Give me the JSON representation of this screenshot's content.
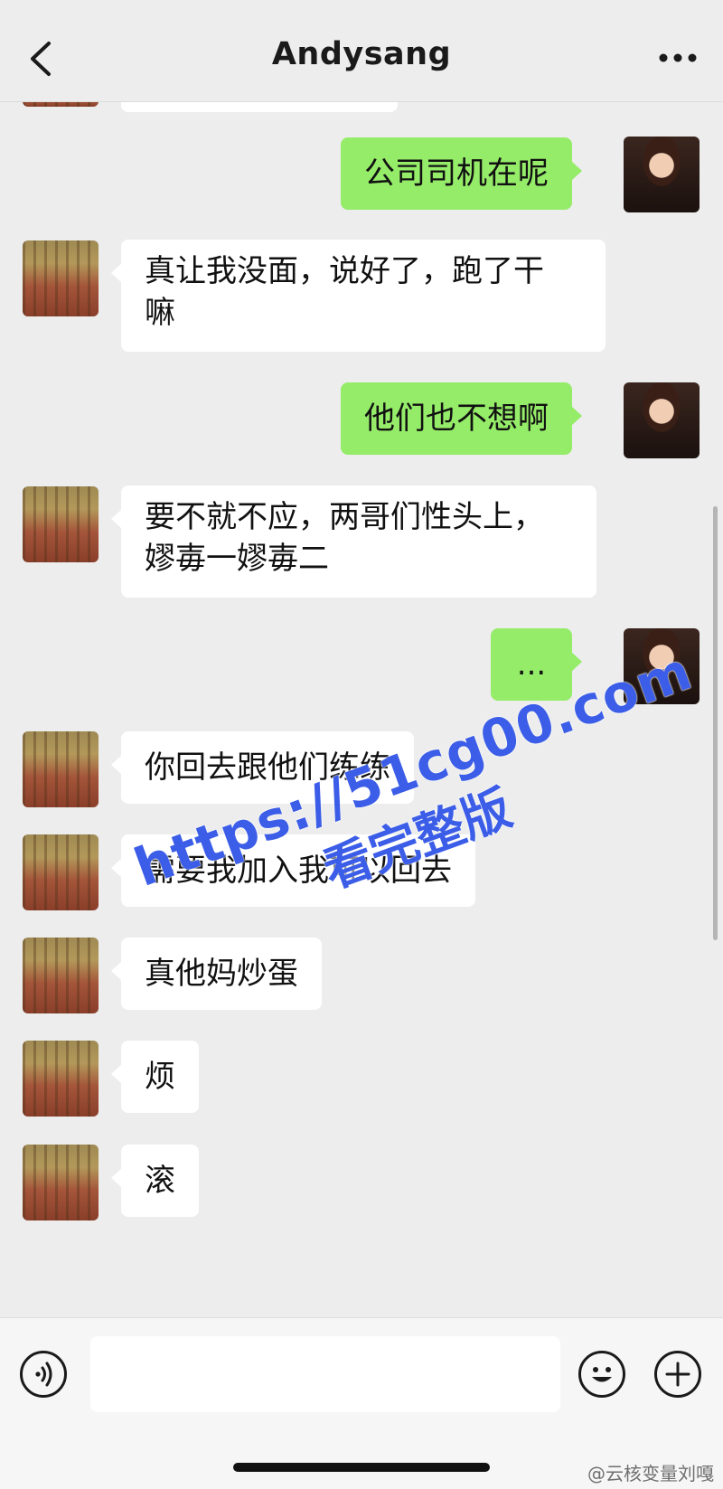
{
  "header": {
    "title": "Andysang"
  },
  "messages": [
    {
      "side": "right",
      "text": "公司司机在呢"
    },
    {
      "side": "left",
      "text": "真让我没面，说好了，跑了干\n嘛"
    },
    {
      "side": "right",
      "text": "他们也不想啊"
    },
    {
      "side": "left",
      "text": "要不就不应，两哥们性头上，\n嫪毐一嫪毐二"
    },
    {
      "side": "right",
      "text": "..."
    },
    {
      "side": "left",
      "text": "你回去跟他们练练"
    },
    {
      "side": "left",
      "text": "需要我加入我可以回去"
    },
    {
      "side": "left",
      "text": "真他妈炒蛋"
    },
    {
      "side": "left",
      "text": "烦"
    },
    {
      "side": "left",
      "text": "滚"
    }
  ],
  "watermark": {
    "line1": "https://51cg00.com",
    "line2": "看完整版"
  },
  "input_bar": {
    "value": ""
  },
  "credit": "@云核变量刘嘎",
  "icons": [
    "back-chevron-icon",
    "more-dots-icon",
    "voice-icon",
    "emoji-icon",
    "plus-icon"
  ],
  "colors": {
    "background": "#ededed",
    "outgoing_bubble": "#95ec69",
    "incoming_bubble": "#ffffff",
    "watermark": "#3b5de7"
  }
}
